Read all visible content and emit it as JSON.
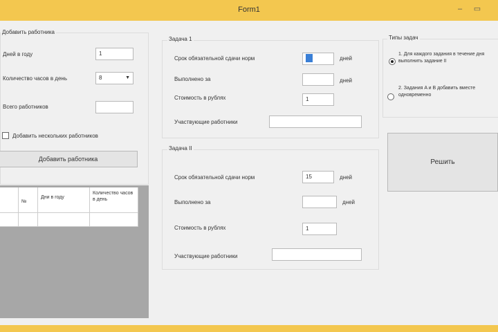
{
  "window": {
    "title": "Form1",
    "minimize": "–",
    "maximize": "▭"
  },
  "add_group": {
    "title": "Добавить работника",
    "days_label": "Дней в году",
    "days_value": "1",
    "hours_label": "Количество часов в день",
    "hours_value": "8",
    "total_label": "Всего работников",
    "total_value": "",
    "checkbox_label": "Добавить нескольких работников",
    "add_button": "Добавить работника"
  },
  "table": {
    "headers": [
      "№",
      "Дни в году",
      "Количество часов в день"
    ],
    "rows": [
      [
        "",
        "",
        ""
      ]
    ]
  },
  "task1": {
    "title": "Задача 1",
    "limit_label": "Срок обязательной сдачи норм",
    "limit_value": "",
    "limit_unit": "дней",
    "done_label": "Выполнено за",
    "done_value": "",
    "done_unit": "дней",
    "cost_label": "Стоимость в рублях",
    "cost_value": "1",
    "workers_label": "Участвующие работники",
    "workers_value": ""
  },
  "task2": {
    "title": "Задача II",
    "limit_label": "Срок обязательной сдачи норм",
    "limit_value": "15",
    "limit_unit": "дней",
    "done_label": "Выполнено за",
    "done_value": "",
    "done_unit": "дней",
    "cost_label": "Стоимость в рублях",
    "cost_value": "1",
    "workers_label": "Участвующие работники",
    "workers_value": ""
  },
  "task_type": {
    "title": "Типы задач",
    "option1": "1. Для каждого задания в течение дня выполнить задание II",
    "option2": "2. Задания A и B добавить вместе одновременно"
  },
  "solve_button": "Решить"
}
